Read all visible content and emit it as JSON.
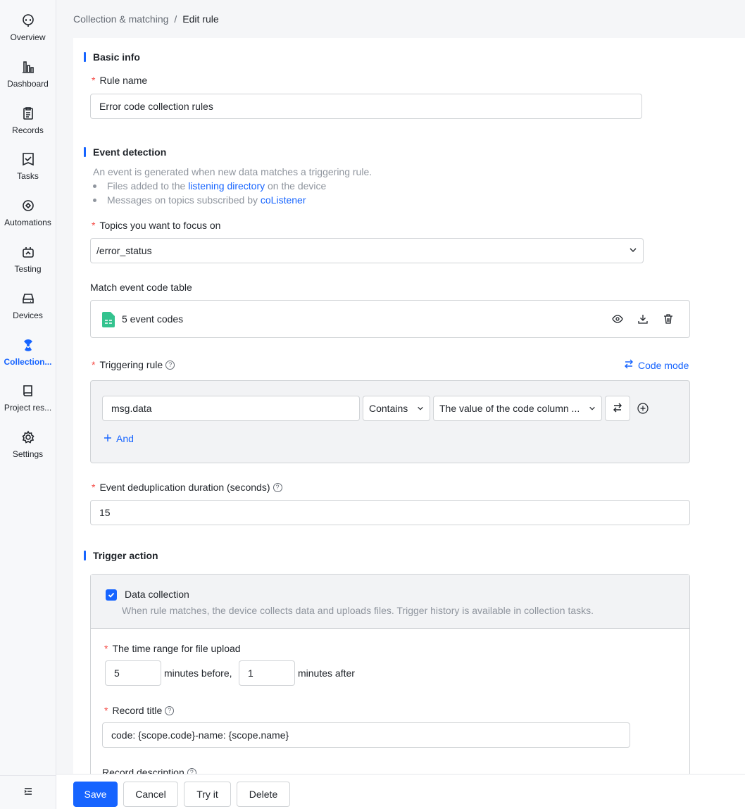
{
  "sidebar": {
    "items": [
      {
        "label": "Overview",
        "icon": "robot-face-icon"
      },
      {
        "label": "Dashboard",
        "icon": "bar-chart-icon"
      },
      {
        "label": "Records",
        "icon": "clipboard-icon"
      },
      {
        "label": "Tasks",
        "icon": "task-check-icon"
      },
      {
        "label": "Automations",
        "icon": "automation-icon"
      },
      {
        "label": "Testing",
        "icon": "testing-icon"
      },
      {
        "label": "Devices",
        "icon": "device-drive-icon"
      },
      {
        "label": "Collection...",
        "icon": "collection-radiation-icon",
        "active": true
      },
      {
        "label": "Project res...",
        "icon": "book-icon"
      },
      {
        "label": "Settings",
        "icon": "gear-icon"
      }
    ],
    "collapse_icon": "collapse-sidebar-icon"
  },
  "breadcrumb": {
    "parent": "Collection & matching",
    "separator": "/",
    "current": "Edit rule"
  },
  "basic_info": {
    "title": "Basic info",
    "rule_name_label": "Rule name",
    "rule_name_value": "Error code collection rules"
  },
  "event_detection": {
    "title": "Event detection",
    "description": "An event is generated when new data matches a triggering rule.",
    "bullet1_prefix": "Files added to the ",
    "bullet1_link": "listening directory",
    "bullet1_suffix": " on the device",
    "bullet2_prefix": "Messages on topics subscribed by ",
    "bullet2_link": "coListener",
    "topics_label": "Topics you want to focus on",
    "topics_value": "/error_status",
    "code_table_label": "Match event code table",
    "code_table_file": "5 event codes",
    "triggering_rule_label": "Triggering rule",
    "code_mode_label": "Code mode",
    "condition_field": "msg.data",
    "condition_operator": "Contains",
    "condition_value": "The value of the code column ...",
    "and_label": "And",
    "dedup_label": "Event deduplication duration (seconds)",
    "dedup_value": "15"
  },
  "trigger_action": {
    "title": "Trigger action",
    "data_collection_label": "Data collection",
    "data_collection_checked": true,
    "data_collection_desc": "When rule matches, the device collects data and uploads files. Trigger history is available in collection tasks.",
    "time_range_label": "The time range for file upload",
    "minutes_before_value": "5",
    "minutes_before_text": "minutes before,",
    "minutes_after_value": "1",
    "minutes_after_text": "minutes after",
    "record_title_label": "Record title",
    "record_title_value": "code: {scope.code}-name: {scope.name}",
    "record_desc_label": "Record description"
  },
  "footer": {
    "save": "Save",
    "cancel": "Cancel",
    "try_it": "Try it",
    "delete": "Delete"
  },
  "colors": {
    "accent": "#1664ff",
    "required": "#f54a45",
    "file_icon": "#34c38f"
  }
}
